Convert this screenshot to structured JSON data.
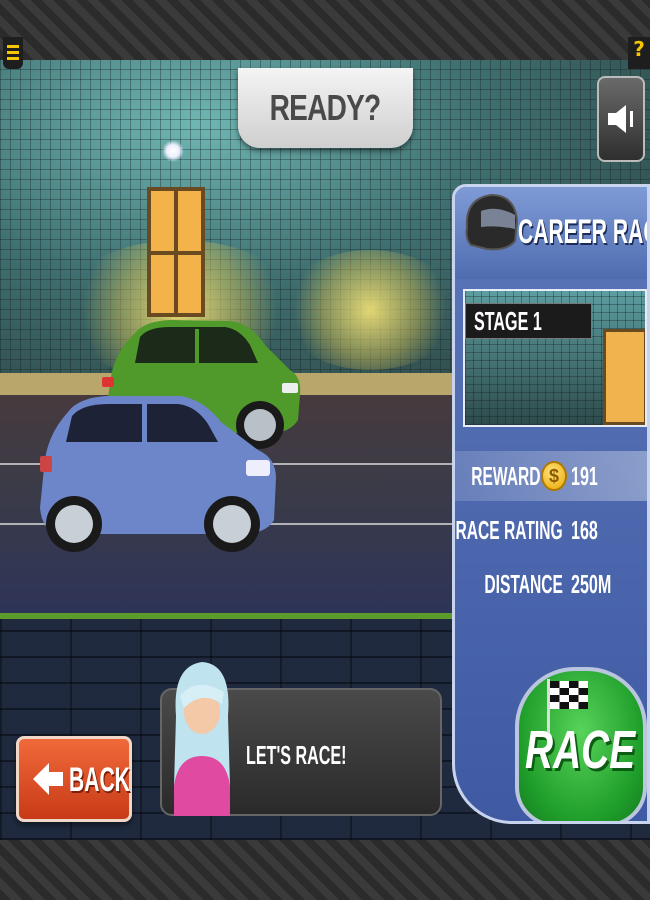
{
  "ready_banner": "READY?",
  "career_panel": {
    "title": "CAREER RACE",
    "stage_label": "STAGE 1",
    "reward_label": "REWARD",
    "reward_value": "191",
    "race_rating_label": "RACE RATING",
    "race_rating_value": "168",
    "distance_label": "DISTANCE",
    "distance_value": "250M"
  },
  "buttons": {
    "race": "RACE",
    "back": "BACK"
  },
  "dialog": {
    "text": "LET'S RACE!"
  },
  "colors": {
    "player_car": "#6d86c9",
    "opponent_car": "#4f9a2a",
    "race_button": "#2aa836",
    "back_button": "#e0532a",
    "panel": "#4c67ac",
    "menu_accent": "#f6c400"
  },
  "icons": {
    "menu": "menu-icon",
    "help": "help-icon",
    "sound": "speaker-icon",
    "helmet": "helmet-icon",
    "coin": "coin-icon",
    "flag": "checkered-flag-icon",
    "back_arrow": "arrow-left-icon"
  },
  "icon_glyphs": {
    "help": "?",
    "coin": "$"
  }
}
